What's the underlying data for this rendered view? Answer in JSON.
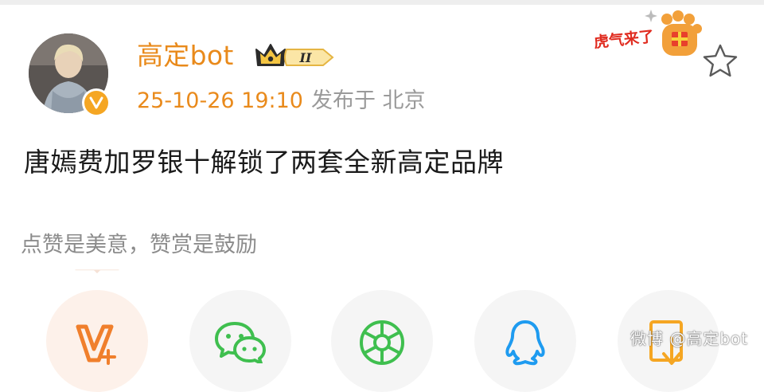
{
  "post": {
    "user_name": "高定bot",
    "level": "II",
    "date": "25-10-26 19:10",
    "location": "发布于 北京",
    "text": "唐嫣费加罗银十解锁了两套全新高定品牌",
    "sticker_text": "虎气来了",
    "reward_hint": "点赞是美意，赞赏是鼓励"
  },
  "share": [
    {
      "name": "reward",
      "icon": "v-plus-icon",
      "bg": "#fdf1ea"
    },
    {
      "name": "wechat",
      "icon": "wechat-icon",
      "bg": "#f5f5f5"
    },
    {
      "name": "moments",
      "icon": "moments-icon",
      "bg": "#f5f5f5"
    },
    {
      "name": "qq",
      "icon": "qq-icon",
      "bg": "#f5f5f5"
    },
    {
      "name": "save",
      "icon": "save-image-icon",
      "bg": "#f5f5f5"
    }
  ],
  "watermark": "微博 @高定bot",
  "colors": {
    "accent": "#e98a1b",
    "reward": "#f07f2c",
    "green": "#3fbf4f",
    "blue": "#1e9bf0",
    "orange": "#f5a623"
  }
}
